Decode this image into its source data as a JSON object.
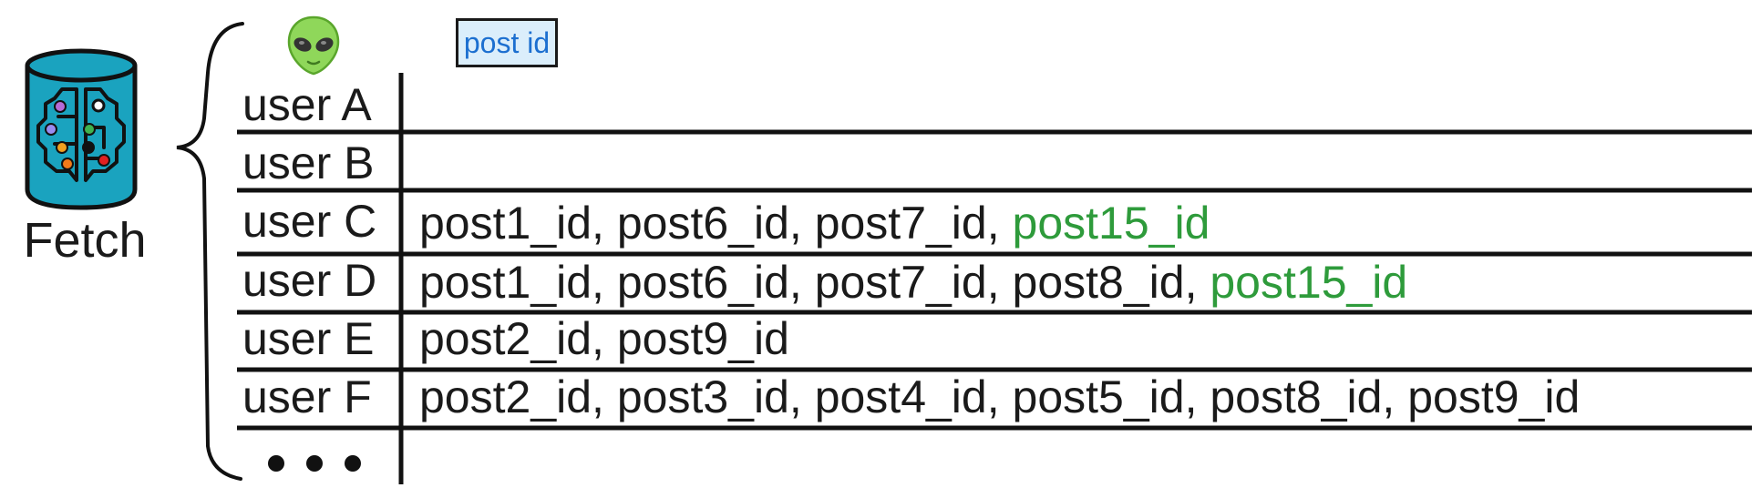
{
  "fetch": {
    "label": "Fetch",
    "icon": "database-brain-icon"
  },
  "header": {
    "user_icon": "alien-icon",
    "column_tag": "post id"
  },
  "rows": [
    {
      "user": "user A",
      "posts": []
    },
    {
      "user": "user B",
      "posts": []
    },
    {
      "user": "user C",
      "posts": [
        {
          "id": "post1_id",
          "highlight": false
        },
        {
          "id": "post6_id",
          "highlight": false
        },
        {
          "id": "post7_id",
          "highlight": false
        },
        {
          "id": "post15_id",
          "highlight": true
        }
      ]
    },
    {
      "user": "user D",
      "posts": [
        {
          "id": "post1_id",
          "highlight": false
        },
        {
          "id": "post6_id",
          "highlight": false
        },
        {
          "id": "post7_id",
          "highlight": false
        },
        {
          "id": "post8_id",
          "highlight": false
        },
        {
          "id": "post15_id",
          "highlight": true
        }
      ]
    },
    {
      "user": "user E",
      "posts": [
        {
          "id": "post2_id",
          "highlight": false
        },
        {
          "id": "post9_id",
          "highlight": false
        }
      ]
    },
    {
      "user": "user F",
      "posts": [
        {
          "id": "post2_id",
          "highlight": false
        },
        {
          "id": "post3_id",
          "highlight": false
        },
        {
          "id": "post4_id",
          "highlight": false
        },
        {
          "id": "post5_id",
          "highlight": false
        },
        {
          "id": "post8_id",
          "highlight": false
        },
        {
          "id": "post9_id",
          "highlight": false
        }
      ]
    }
  ],
  "more_rows": "•••",
  "colors": {
    "highlight": "#2e9b3b",
    "tag_text": "#1c6fd0",
    "tag_background": "#dbeefb",
    "database": "#1aa3bf"
  }
}
